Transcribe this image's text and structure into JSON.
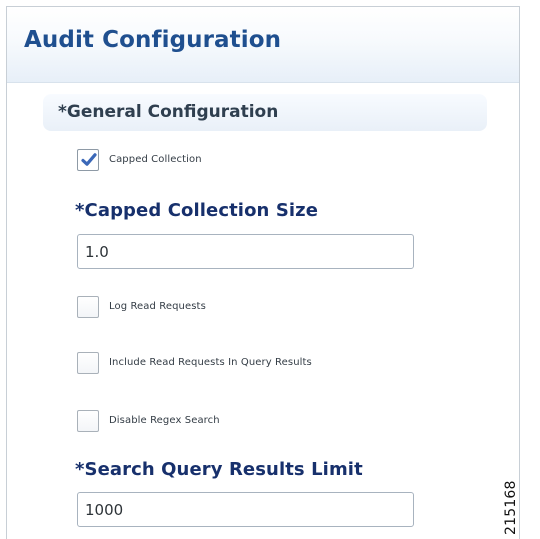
{
  "panel": {
    "title": "Audit Configuration"
  },
  "section": {
    "title": "*General Configuration"
  },
  "checkboxes": {
    "capped_collection": {
      "label": "Capped Collection",
      "checked": true
    },
    "log_read_requests": {
      "label": "Log Read Requests",
      "checked": false
    },
    "include_read_requests": {
      "label": "Include Read Requests In Query Results",
      "checked": false
    },
    "disable_regex_search": {
      "label": "Disable Regex Search",
      "checked": false
    }
  },
  "fields": {
    "capped_collection_size": {
      "label": "*Capped Collection Size",
      "value": "1.0"
    },
    "search_query_results_limit": {
      "label": "*Search Query Results Limit",
      "value": "1000"
    }
  },
  "figure_id": "215168",
  "colors": {
    "title": "#1f4f8f",
    "label": "#17306c",
    "check": "#3b68b8"
  },
  "icons": {
    "checked": "checkmark-icon"
  }
}
